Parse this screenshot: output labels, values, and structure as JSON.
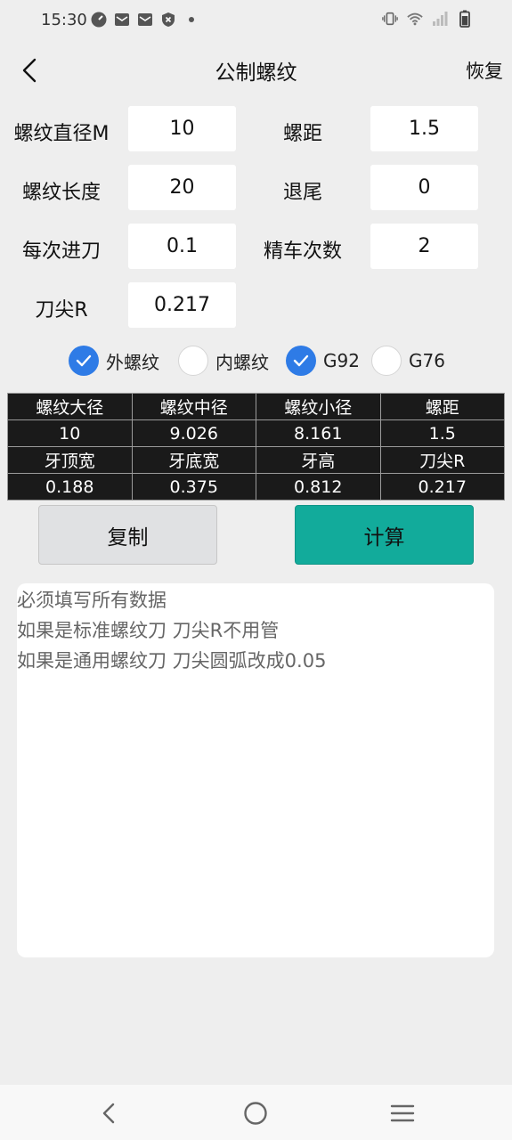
{
  "status_bar": {
    "time": "15:30",
    "left_icons": [
      "speedometer-icon",
      "mail-icon",
      "mail-icon",
      "shield-icon",
      "dot-icon"
    ],
    "right_icons": [
      "vibrate-icon",
      "wifi-icon",
      "signal-icon",
      "battery-icon"
    ]
  },
  "app_bar": {
    "title": "公制螺纹",
    "restore_label": "恢复"
  },
  "form": {
    "diameter_label": "螺纹直径M",
    "diameter_value": "10",
    "pitch_label": "螺距",
    "pitch_value": "1.5",
    "length_label": "螺纹长度",
    "length_value": "20",
    "runout_label": "退尾",
    "runout_value": "0",
    "feed_label": "每次进刀",
    "feed_value": "0.1",
    "finish_label": "精车次数",
    "finish_value": "2",
    "tip_label": "刀尖R",
    "tip_value": "0.217"
  },
  "options": [
    {
      "label": "外螺纹",
      "checked": true
    },
    {
      "label": "内螺纹",
      "checked": false
    },
    {
      "label": "G92",
      "checked": true
    },
    {
      "label": "G76",
      "checked": false
    }
  ],
  "results": {
    "row1": [
      "螺纹大径",
      "螺纹中径",
      "螺纹小径",
      "螺距"
    ],
    "row2": [
      "10",
      "9.026",
      "8.161",
      "1.5"
    ],
    "row3": [
      "牙顶宽",
      "牙底宽",
      "牙高",
      "刀尖R"
    ],
    "row4": [
      "0.188",
      "0.375",
      "0.812",
      "0.217"
    ]
  },
  "buttons": {
    "copy_label": "复制",
    "calc_label": "计算"
  },
  "output": {
    "lines": [
      "必须填写所有数据",
      "如果是标准螺纹刀 刀尖R不用管",
      "如果是通用螺纹刀 刀尖圆弧改成0.05"
    ]
  },
  "colors": {
    "accent_blue": "#2e7be6",
    "calc_teal": "#12ab9b",
    "table_bg": "#1a1a1a",
    "background": "#eeeeee"
  }
}
